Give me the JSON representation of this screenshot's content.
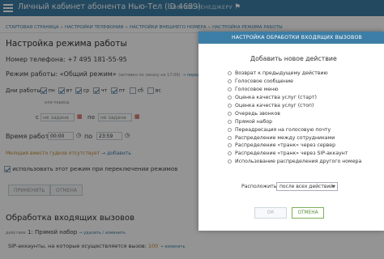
{
  "header": {
    "title": "Личный кабинет абонента Нью-Тел (ID 4689)",
    "manager_link": "ЗВОНОК МЕНЕДЖЕРУ"
  },
  "breadcrumbs": [
    "СТАРТОВАЯ СТРАНИЦА",
    "НАСТРОЙКИ ТЕЛЕФОНИИ",
    "НАСТРОЙКИ ВНЕШНЕГО НОМЕРА",
    "НАСТРОЙКА РЕЖИМА РАБОТЫ"
  ],
  "page": {
    "title": "Настройка режима работы",
    "phone": "Номер телефона: +7 495 181-55-95",
    "mode_label": "Режим работы: «Общий режим»",
    "mode_note": "(активен по заказу на 17:09)",
    "mode_link": "переименовать",
    "days_label": "Дни работы:",
    "days": [
      "пн",
      "вт",
      "ср",
      "чт",
      "пт",
      "сб",
      "вс"
    ],
    "period_note": "или период",
    "date_from_prefix": "с",
    "date_from_placeholder": "не задана",
    "date_to_prefix": "по",
    "date_to_placeholder": "не задана",
    "time_label": "Время работы: с",
    "time_from": "00:00",
    "time_to_prefix": "по",
    "time_to": "23:59",
    "melody_text": "Мелодия вместо гудков отсутствует",
    "melody_link": "добавить",
    "use_mode_text": "использовать этот режим при переключении режимов",
    "apply_btn": "ПРИМЕНИТЬ",
    "cancel_btn": "ОТМЕНА",
    "incoming_title": "Обработка входящих вызовов",
    "action_line_prefix": "действие",
    "action_line_text": "1: Прямой набор",
    "action_links": "удалить / изменить",
    "sip_text": "SIP-аккаунты, на которые осуществляется вызов:",
    "sip_value": "100",
    "sip_link": "изменить"
  },
  "modal": {
    "title": "НАСТРОЙКА ОБРАБОТКИ ВХОДЯЩИХ ВЫЗОВОВ",
    "subtitle": "Добавить новое действие",
    "options": [
      "Возврат к предыдущему действию",
      "Голосовое сообщение",
      "Голосовое меню",
      "Оценка качества услуг (старт)",
      "Оценка качества услуг (стоп)",
      "Очередь звонков",
      "Прямой набор",
      "Переадресация на голосовую почту",
      "Распределение между сотрудниками",
      "Распределение «транк» через сервер",
      "Распределение «транк» через SIP-аккаунт",
      "Использование распределения другого номера"
    ],
    "place_label": "Расположить",
    "place_value": "после всех действий",
    "ok_btn": "ОК",
    "cancel_btn": "ОТМЕНА"
  }
}
